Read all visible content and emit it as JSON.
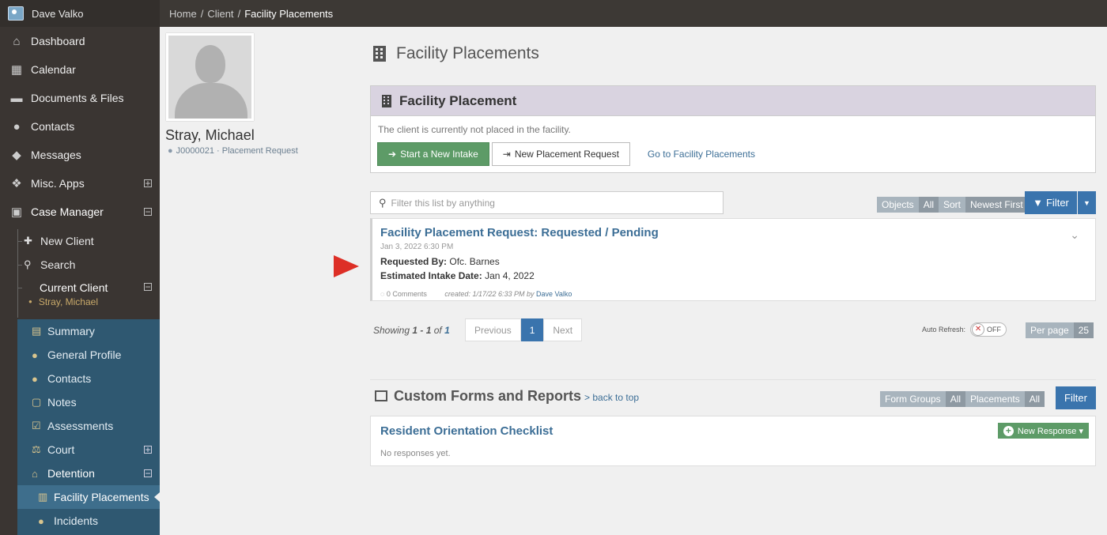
{
  "user": {
    "name": "Dave Valko"
  },
  "nav": {
    "items": [
      {
        "label": "Dashboard",
        "icon": "home-icon"
      },
      {
        "label": "Calendar",
        "icon": "calendar-icon"
      },
      {
        "label": "Documents & Files",
        "icon": "folder-icon"
      },
      {
        "label": "Contacts",
        "icon": "users-icon"
      },
      {
        "label": "Messages",
        "icon": "comments-icon"
      },
      {
        "label": "Misc. Apps",
        "icon": "cubes-icon"
      },
      {
        "label": "Case Manager",
        "icon": "briefcase-icon"
      }
    ],
    "case_manager": {
      "new_client": "New Client",
      "search": "Search",
      "current_client": "Current Client",
      "current_client_name": "Stray, Michael",
      "sub": [
        "Summary",
        "General Profile",
        "Contacts",
        "Notes",
        "Assessments",
        "Court",
        "Detention",
        "Facility Placements",
        "Incidents"
      ]
    }
  },
  "breadcrumb": [
    "Home",
    "Client",
    "Facility Placements"
  ],
  "client": {
    "name": "Stray, Michael",
    "meta": "J0000021 · Placement Request"
  },
  "page_title": "Facility Placements",
  "facility_panel": {
    "title": "Facility Placement",
    "text": "The client is currently not placed in the facility.",
    "start_intake": "Start a New Intake",
    "new_request": "New Placement Request",
    "goto": "Go to Facility Placements"
  },
  "filter": {
    "placeholder": "Filter this list by anything",
    "objects_label": "Objects",
    "objects_value": "All",
    "sort_label": "Sort",
    "sort_value": "Newest First",
    "filter_button": "Filter"
  },
  "request": {
    "title": "Facility Placement Request: Requested / Pending",
    "date": "Jan 3, 2022 6:30 PM",
    "requested_by_label": "Requested By:",
    "requested_by": "Ofc. Barnes",
    "intake_label": "Estimated Intake Date:",
    "intake_date": "Jan 4, 2022",
    "comments": "0 Comments",
    "created": "created: 1/17/22 6:33 PM by",
    "created_by": "Dave Valko"
  },
  "pagination": {
    "showing_prefix": "Showing",
    "range": "1 - 1",
    "of": "of",
    "total": "1",
    "previous": "Previous",
    "page": "1",
    "next": "Next",
    "auto_refresh": "Auto Refresh:",
    "toggle": "OFF",
    "per_page_label": "Per page",
    "per_page": "25"
  },
  "custom_forms": {
    "title": "Custom Forms and Reports",
    "back": "> back to top",
    "form_groups_label": "Form Groups",
    "form_groups_value": "All",
    "placements_label": "Placements",
    "placements_value": "All",
    "filter_button": "Filter",
    "card_title": "Resident Orientation Checklist",
    "new_response": "New Response ▾",
    "empty": "No responses yet."
  },
  "colors": {
    "sidebar": "#3a3532",
    "sidebar_blue": "#2f5871",
    "accent_blue": "#3a74ad",
    "green": "#5d9b67",
    "panel_header": "#d9d3e0",
    "arrow": "#e0433a"
  }
}
